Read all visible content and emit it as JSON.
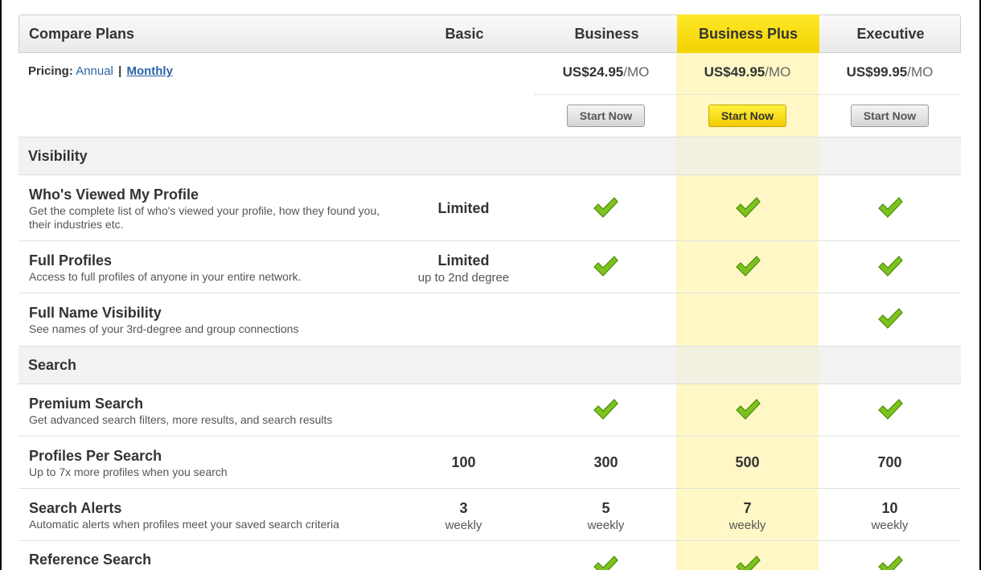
{
  "header": {
    "title": "Compare Plans",
    "plans": [
      "Basic",
      "Business",
      "Business Plus",
      "Executive"
    ]
  },
  "pricing": {
    "label": "Pricing:",
    "annual": "Annual",
    "separator": "|",
    "monthly": "Monthly",
    "prices": [
      {
        "amount": "US$24.95",
        "unit": "/MO"
      },
      {
        "amount": "US$49.95",
        "unit": "/MO"
      },
      {
        "amount": "US$99.95",
        "unit": "/MO"
      }
    ],
    "button_label": "Start Now"
  },
  "sections": {
    "visibility": "Visibility",
    "search": "Search"
  },
  "features": {
    "whos_viewed": {
      "title": "Who's Viewed My Profile",
      "desc": "Get the complete list of who's viewed your profile, how they found you, their industries etc.",
      "basic": "Limited"
    },
    "full_profiles": {
      "title": "Full Profiles",
      "desc": "Access to full profiles of anyone in your entire network.",
      "basic": "Limited",
      "basic_sub": "up to 2nd degree"
    },
    "full_name": {
      "title": "Full Name Visibility",
      "desc": "See names of your 3rd-degree and group connections"
    },
    "premium_search": {
      "title": "Premium Search",
      "desc": "Get advanced search filters, more results, and search results"
    },
    "profiles_per_search": {
      "title": "Profiles Per Search",
      "desc": "Up to 7x more profiles when you search",
      "values": [
        "100",
        "300",
        "500",
        "700"
      ]
    },
    "search_alerts": {
      "title": "Search Alerts",
      "desc": "Automatic alerts when profiles meet your saved search criteria",
      "values": [
        "3",
        "5",
        "7",
        "10"
      ],
      "sub": "weekly"
    },
    "reference_search": {
      "title": "Reference Search"
    }
  },
  "colors": {
    "highlight": "#fff8c6",
    "highlight_header": "#f8dc14",
    "check_green": "#7cc31e",
    "link_blue": "#2a65a8"
  },
  "icons": {
    "check": "check-icon"
  }
}
